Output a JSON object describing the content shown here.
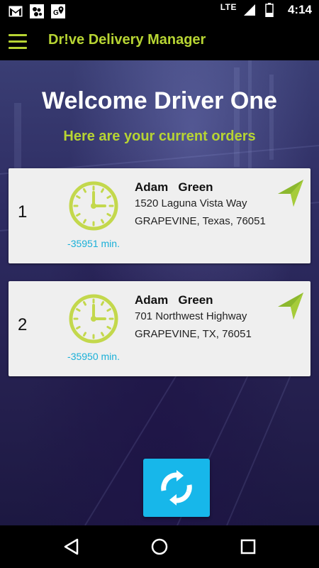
{
  "status_bar": {
    "network": "LTE",
    "time": "4:14",
    "icons": [
      "gmail-icon",
      "photos-icon",
      "maps-notification-icon",
      "signal-icon",
      "battery-icon"
    ]
  },
  "app_bar": {
    "title": "Dr!ve Delivery Manager",
    "menu_icon": "hamburger-menu-icon"
  },
  "main": {
    "welcome": "Welcome Driver One",
    "subtitle": "Here are your current orders",
    "orders": [
      {
        "number": "1",
        "name": "Adam   Green",
        "address_line1": "1520 Laguna Vista Way",
        "address_line2": "GRAPEVINE, Texas, 76051",
        "minutes": "-35951 min."
      },
      {
        "number": "2",
        "name": "Adam   Green",
        "address_line1": "701 Northwest Highway",
        "address_line2": "GRAPEVINE, TX, 76051",
        "minutes": "-35950 min."
      }
    ],
    "refresh_icon": "refresh-icon"
  },
  "colors": {
    "accent": "#b7d433",
    "refresh_button": "#17b7ea",
    "minutes_text": "#1ab0d8"
  },
  "nav_bar": {
    "icons": [
      "back-icon",
      "home-icon",
      "recents-icon"
    ]
  }
}
